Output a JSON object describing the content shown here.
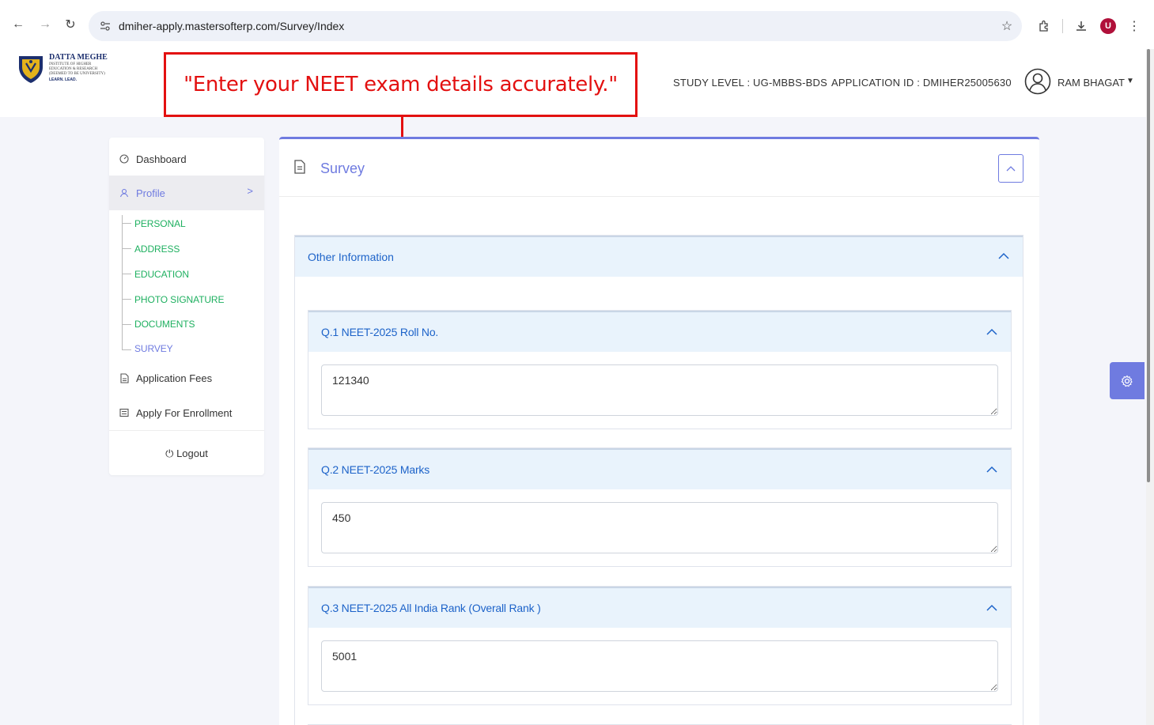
{
  "browser": {
    "url": "dmiher-apply.mastersofterp.com/Survey/Index",
    "profile_letter": "U"
  },
  "logo": {
    "title": "DATTA MEGHE",
    "sub1": "INSTITUTE OF HIGHER",
    "sub2": "EDUCATION & RESEARCH",
    "sub3": "(DEEMED TO BE UNIVERSITY)",
    "tag": "LEARN. LEAD."
  },
  "callout": {
    "text": "\"Enter your NEET exam details accurately.\"",
    "color": "#e31010"
  },
  "header": {
    "study_level": "STUDY LEVEL : UG-MBBS-BDS",
    "application_id": "APPLICATION ID : DMIHER25005630",
    "user_name": "RAM BHAGAT"
  },
  "sidebar": {
    "dashboard": "Dashboard",
    "profile": "Profile",
    "sub_items": [
      "PERSONAL",
      "ADDRESS",
      "EDUCATION",
      "PHOTO SIGNATURE",
      "DOCUMENTS",
      "SURVEY"
    ],
    "application_fees": "Application Fees",
    "apply_enrollment": "Apply For Enrollment",
    "logout": "Logout"
  },
  "main": {
    "title": "Survey",
    "section_title": "Other Information",
    "questions": [
      {
        "label": "Q.1  NEET-2025 Roll No.",
        "value": "121340"
      },
      {
        "label": "Q.2  NEET-2025 Marks",
        "value": "450"
      },
      {
        "label": "Q.3  NEET-2025 All India Rank (Overall Rank )",
        "value": "5001"
      }
    ]
  },
  "colors": {
    "accent": "#6f7be0",
    "link_blue": "#1d63c9",
    "green": "#1fb060",
    "panel_head": "#e9f3fc"
  }
}
